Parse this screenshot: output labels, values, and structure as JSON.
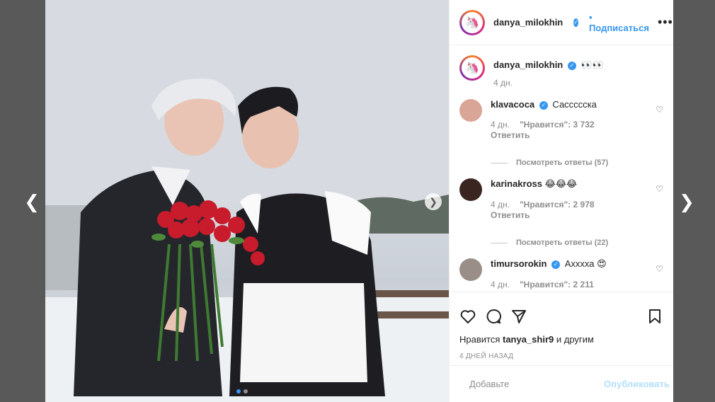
{
  "post": {
    "author": "danya_milokhin",
    "follow_label": "• Подписаться",
    "caption": "👀👀",
    "caption_time": "4 дн."
  },
  "comments": [
    {
      "user": "klavacoca",
      "text": "Сассссска",
      "time": "4 дн.",
      "likes": "\"Нравится\": 3 732",
      "reply": "Ответить",
      "view_replies": "Посмотреть ответы (57)",
      "avatar_color": "#d8a596"
    },
    {
      "user": "karinakross",
      "text": "😂😂😂",
      "time": "4 дн.",
      "likes": "\"Нравится\": 2 978",
      "reply": "Ответить",
      "view_replies": "Посмотреть ответы (22)",
      "avatar_color": "#3a2520"
    },
    {
      "user": "timursorokin",
      "text": "Ахххха 😍",
      "time": "4 дн.",
      "likes": "\"Нравится\": 2 211",
      "reply": "",
      "view_replies": "",
      "avatar_color": "#9a8f88"
    }
  ],
  "likes_line": {
    "prefix": "Нравится ",
    "user": "tanya_shir9",
    "suffix": " и другим"
  },
  "post_date": "4 ДНЕЙ НАЗАД",
  "comment_input": {
    "placeholder": "Добавьте"
  },
  "publish_label": "Опубликовать",
  "icons": {
    "prev": "chevron-left-icon",
    "next": "chevron-right-icon",
    "like": "heart-icon",
    "comment": "speech-bubble-icon",
    "share": "paper-plane-icon",
    "save": "bookmark-icon",
    "emoji": "smiley-icon"
  },
  "colors": {
    "accent": "#3897f0",
    "publish_disabled": "#b2dffc"
  }
}
